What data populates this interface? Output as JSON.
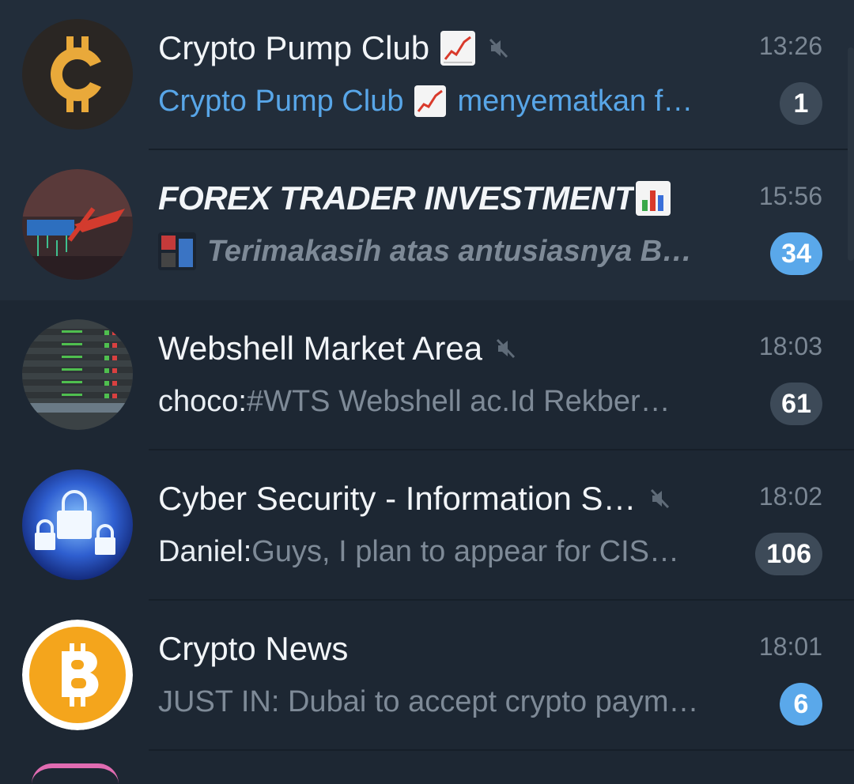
{
  "chats": [
    {
      "title": "Crypto Pump Club",
      "title_emoji": "chart-increasing-emoji",
      "muted": true,
      "time": "13:26",
      "preview_sender": "",
      "preview_pre": "Crypto Pump Club",
      "preview_text": "menyematkan f…",
      "unread": "1",
      "avatar": "crypto-coin-logo"
    },
    {
      "title": "FOREX TRADER INVESTMENT",
      "title_emoji": "bar-chart-emoji",
      "muted": false,
      "time": "15:56",
      "preview_sender": "",
      "preview_text": "Terimakasih atas antusiasnya   B…",
      "unread": "34",
      "avatar": "forex-trader-logo"
    },
    {
      "title": "Webshell Market Area",
      "muted": true,
      "time": "18:03",
      "preview_sender": "choco: ",
      "preview_text": "#WTS  Webshell ac.Id  Rekber…",
      "unread": "61",
      "avatar": "webshell-list-image"
    },
    {
      "title": "Cyber Security - Information S…",
      "muted": true,
      "time": "18:02",
      "preview_sender": "Daniel: ",
      "preview_text": "Guys, I plan to appear for CIS…",
      "unread": "106",
      "avatar": "padlock-image"
    },
    {
      "title": "Crypto News",
      "muted": false,
      "time": "18:01",
      "preview_sender": "",
      "preview_text": "JUST IN: Dubai to accept crypto paym…",
      "unread": "6",
      "avatar": "bitcoin-logo"
    }
  ],
  "colors": {
    "background": "#1d2733",
    "badge_active": "#5aa8ea",
    "badge_muted": "#3d4a58",
    "link_blue": "#58a6e8"
  }
}
